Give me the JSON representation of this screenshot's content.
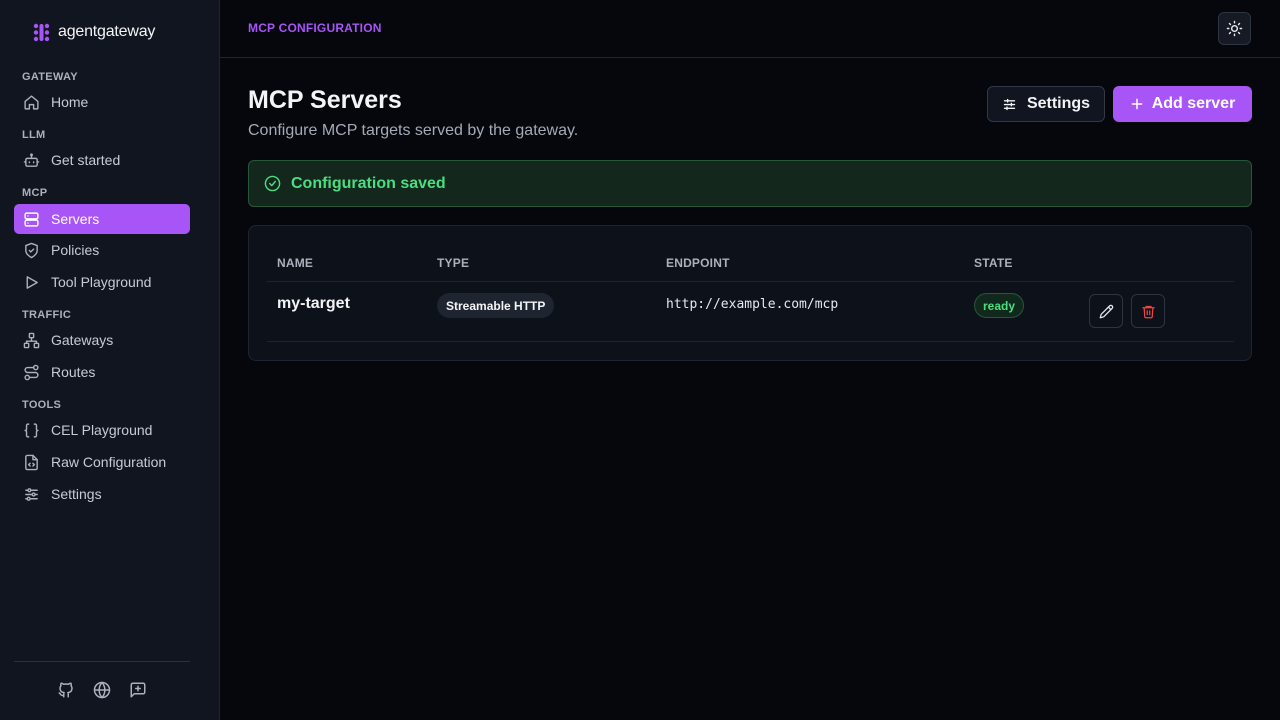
{
  "app": {
    "logo_text": "agentgateway"
  },
  "sidebar": {
    "sections": [
      {
        "title": "GATEWAY",
        "items": [
          {
            "label": "Home",
            "icon": "home-icon"
          }
        ]
      },
      {
        "title": "LLM",
        "items": [
          {
            "label": "Get started",
            "icon": "bot-icon"
          }
        ]
      },
      {
        "title": "MCP",
        "items": [
          {
            "label": "Servers",
            "icon": "server-icon",
            "active": true
          },
          {
            "label": "Policies",
            "icon": "shield-icon"
          },
          {
            "label": "Tool Playground",
            "icon": "play-icon"
          }
        ]
      },
      {
        "title": "TRAFFIC",
        "items": [
          {
            "label": "Gateways",
            "icon": "network-icon"
          },
          {
            "label": "Routes",
            "icon": "route-icon"
          }
        ]
      },
      {
        "title": "TOOLS",
        "items": [
          {
            "label": "CEL Playground",
            "icon": "braces-icon"
          },
          {
            "label": "Raw Configuration",
            "icon": "file-code-icon"
          },
          {
            "label": "Settings",
            "icon": "sliders-icon"
          }
        ]
      }
    ],
    "footer_icons": [
      "github-icon",
      "globe-icon",
      "feedback-icon"
    ]
  },
  "header": {
    "breadcrumb": "MCP CONFIGURATION",
    "theme_toggle_icon": "sun-icon"
  },
  "main": {
    "title": "MCP Servers",
    "subtitle": "Configure MCP targets served by the gateway.",
    "settings_button": "Settings",
    "add_button": "Add server",
    "alert": {
      "text": "Configuration saved",
      "icon": "check-circle-icon"
    },
    "table": {
      "columns": {
        "name": "NAME",
        "type": "TYPE",
        "endpoint": "ENDPOINT",
        "state": "STATE"
      },
      "rows": [
        {
          "name": "my-target",
          "type": "Streamable HTTP",
          "endpoint": "http://example.com/mcp",
          "state": "ready"
        }
      ]
    }
  },
  "colors": {
    "accent": "#a855f7",
    "success": "#4ade80",
    "danger": "#ef4444",
    "background": "#05070d"
  }
}
